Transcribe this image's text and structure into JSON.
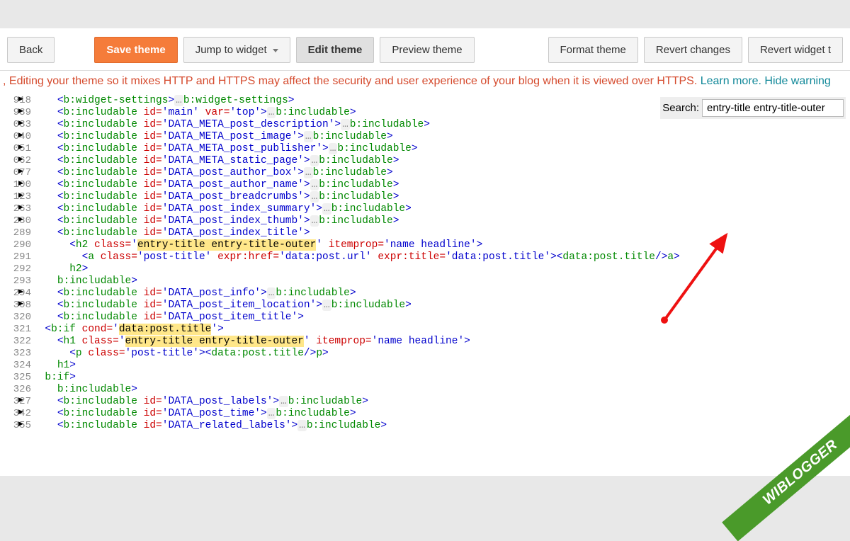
{
  "toolbar": {
    "back": "Back",
    "save": "Save theme",
    "jump": "Jump to widget",
    "edit": "Edit theme",
    "preview": "Preview theme",
    "format": "Format theme",
    "revert_changes": "Revert changes",
    "revert_widget": "Revert widget t"
  },
  "warning": {
    "prefix": ", ",
    "text": "Editing your theme so it mixes HTTP and HTTPS may affect the security and user experience of your blog when it is viewed over HTTPS. ",
    "learn": "Learn more.",
    "hide": " Hide warning"
  },
  "search": {
    "label": "Search:",
    "value": "entry-title entry-title-outer"
  },
  "ribbon": "WIBLOGGER",
  "gutter": [
    "918",
    "939",
    "033",
    "040",
    "051",
    "062",
    "077",
    "100",
    "123",
    "263",
    "280",
    "289",
    "290",
    "291",
    "292",
    "293",
    "294",
    "308",
    "320",
    "321",
    "322",
    "323",
    "324",
    "325",
    "326",
    "327",
    "342",
    "355"
  ],
  "fold_rows": [
    0,
    1,
    2,
    3,
    4,
    5,
    6,
    7,
    8,
    9,
    10,
    16,
    17,
    25,
    26,
    27
  ],
  "code": {
    "l0": {
      "indent": "    ",
      "open": "<",
      "tag": "b:widget-settings",
      "close": ">",
      "dots": "…",
      "copen": "</",
      "ctag": "b:widget-settings",
      "cclose": ">"
    },
    "l1": {
      "indent": "    ",
      "open": "<",
      "tag": "b:includable",
      "sp": " ",
      "a1": "id",
      "eq": "=",
      "v1": "'main'",
      "sp2": " ",
      "a2": "var",
      "v2": "'top'",
      "close": ">",
      "dots": "…",
      "copen": "</",
      "ctag": "b:includable",
      "cclose": ">"
    },
    "inc": [
      {
        "id": "'DATA_META_post_description'"
      },
      {
        "id": "'DATA_META_post_image'"
      },
      {
        "id": "'DATA_META_post_publisher'"
      },
      {
        "id": "'DATA_META_static_page'"
      },
      {
        "id": "'DATA_post_author_box'"
      },
      {
        "id": "'DATA_post_author_name'"
      },
      {
        "id": "'DATA_post_breadcrumbs'"
      },
      {
        "id": "'DATA_post_index_summary'"
      },
      {
        "id": "'DATA_post_index_thumb'"
      }
    ],
    "l11": {
      "indent": "    ",
      "open": "<",
      "tag": "b:includable",
      "sp": " ",
      "a": "id",
      "v": "'DATA_post_index_title'",
      "close": ">"
    },
    "l12": {
      "indent": "      ",
      "open": "<",
      "tag": "h2",
      "sp": " ",
      "a1": "class",
      "eq": "=",
      "q1": "'",
      "hv": "entry-title entry-title-outer",
      "q2": "'",
      "sp2": " ",
      "a2": "itemprop",
      "v2": "'name headline'",
      "close": ">"
    },
    "l13": {
      "indent": "        ",
      "open": "<",
      "tag": "a",
      "sp": " ",
      "a1": "class",
      "v1": "'post-title'",
      "sp2": " ",
      "a2": "expr:href",
      "v2": "'data:post.url'",
      "sp3": " ",
      "a3": "expr:title",
      "v3": "'data:post.title'",
      "close": ">",
      "dopen": "<",
      "dtag": "data:post.title",
      "dclose": "/>",
      "copen": "</",
      "ctag": "a",
      "cclose": ">"
    },
    "l14": {
      "indent": "      ",
      "open": "</",
      "tag": "h2",
      "close": ">"
    },
    "l15": {
      "indent": "    ",
      "open": "</",
      "tag": "b:includable",
      "close": ">"
    },
    "inc2": [
      {
        "id": "'DATA_post_info'"
      },
      {
        "id": "'DATA_post_item_location'"
      }
    ],
    "l18": {
      "indent": "    ",
      "open": "<",
      "tag": "b:includable",
      "sp": " ",
      "a": "id",
      "v": "'DATA_post_item_title'",
      "close": ">"
    },
    "l19": {
      "indent": "  ",
      "open": "<",
      "tag": "b:if",
      "sp": " ",
      "a": "cond",
      "eq": "=",
      "q1": "'",
      "hv": "data:post.title",
      "q2": "'",
      "close": ">"
    },
    "l20": {
      "indent": "    ",
      "open": "<",
      "tag": "h1",
      "sp": " ",
      "a1": "class",
      "eq": "=",
      "q1": "'",
      "hv": "entry-title entry-title-outer",
      "q2": "'",
      "sp2": " ",
      "a2": "itemprop",
      "v2": "'name headline'",
      "close": ">"
    },
    "l21": {
      "indent": "      ",
      "open": "<",
      "tag": "p",
      "sp": " ",
      "a": "class",
      "v": "'post-title'",
      "close": ">",
      "dopen": "<",
      "dtag": "data:post.title",
      "dclose": "/>",
      "copen": "</",
      "ctag": "p",
      "cclose": ">"
    },
    "l22": {
      "indent": "    ",
      "open": "</",
      "tag": "h1",
      "close": ">"
    },
    "l23": {
      "indent": "  ",
      "open": "</",
      "tag": "b:if",
      "close": ">"
    },
    "l24": {
      "indent": "    ",
      "open": "</",
      "tag": "b:includable",
      "close": ">"
    },
    "inc3": [
      {
        "id": "'DATA_post_labels'"
      },
      {
        "id": "'DATA_post_time'"
      },
      {
        "id": "'DATA_related_labels'"
      }
    ]
  }
}
